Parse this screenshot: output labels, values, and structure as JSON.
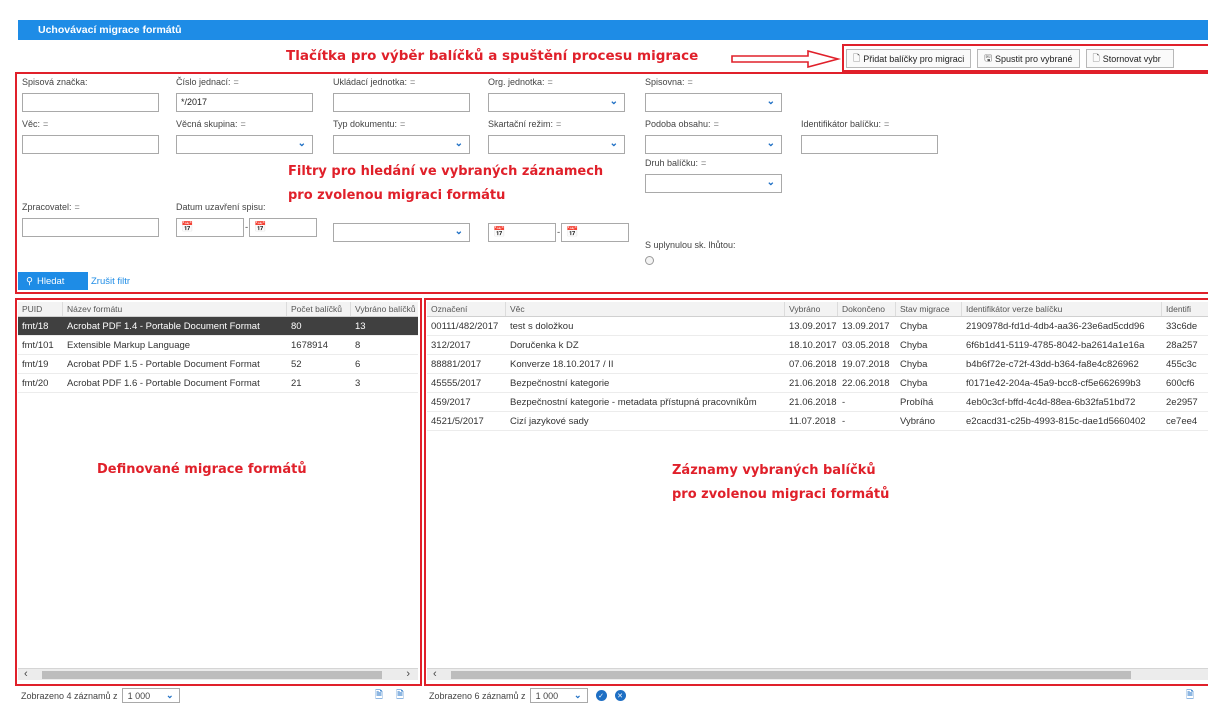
{
  "window": {
    "title": "Uchovávací migrace formátů"
  },
  "annotations": {
    "top": "Tlačítka pro výběr balíčků a spuštění procesu migrace",
    "filters_line1": "Filtry pro hledání ve vybraných záznamech",
    "filters_line2": "pro zvolenou migraci formátu",
    "left_panel": "Definované migrace formátů",
    "right_line1": "Záznamy vybraných balíčků",
    "right_line2": "pro zvolenou migraci formátů"
  },
  "toolbar": {
    "add": "Přidat balíčky pro migraci",
    "run": "Spustit pro vybrané",
    "cancel": "Stornovat vybr"
  },
  "filters": {
    "spisova_znacka": {
      "label": "Spisová značka:",
      "value": ""
    },
    "cislo_jednaci": {
      "label": "Číslo jednací:",
      "eq": "=",
      "value": "*/2017"
    },
    "ukladaci_jednotka": {
      "label": "Ukládací jednotka:",
      "eq": "=",
      "value": ""
    },
    "org_jednotka": {
      "label": "Org. jednotka:",
      "eq": "="
    },
    "spisovna": {
      "label": "Spisovna:",
      "eq": "="
    },
    "vec": {
      "label": "Věc:",
      "eq": "=",
      "value": ""
    },
    "vecna_skupina": {
      "label": "Věcná skupina:",
      "eq": "="
    },
    "typ_dokumentu": {
      "label": "Typ dokumentu:",
      "eq": "="
    },
    "skartacni_rezim": {
      "label": "Skartační režim:",
      "eq": "="
    },
    "podoba_obsahu": {
      "label": "Podoba obsahu:",
      "eq": "="
    },
    "identifikator_balicku": {
      "label": "Identifikátor balíčku:",
      "eq": "=",
      "value": ""
    },
    "druh_balicku": {
      "label": "Druh balíčku:",
      "eq": "="
    },
    "zpracovatel": {
      "label": "Zpracovatel:",
      "eq": "=",
      "value": ""
    },
    "datum_uzavreni": {
      "label": "Datum uzavření spisu:"
    },
    "s_uplynulou": {
      "label": "S uplynulou sk. lhůtou:"
    }
  },
  "buttons": {
    "search": "Hledat",
    "clear": "Zrušit filtr"
  },
  "left_table": {
    "headers": [
      "PUID",
      "Název formátu",
      "Počet balíčků",
      "Vybráno balíčků"
    ],
    "rows": [
      [
        "fmt/18",
        "Acrobat PDF 1.4 - Portable Document Format",
        "80",
        "13"
      ],
      [
        "fmt/101",
        "Extensible Markup Language",
        "1678914",
        "8"
      ],
      [
        "fmt/19",
        "Acrobat PDF 1.5 - Portable Document Format",
        "52",
        "6"
      ],
      [
        "fmt/20",
        "Acrobat PDF 1.6 - Portable Document Format",
        "21",
        "3"
      ]
    ],
    "selected_index": 0
  },
  "right_table": {
    "headers": [
      "Označení",
      "Věc",
      "Vybráno",
      "Dokončeno",
      "Stav migrace",
      "Identifikátor verze balíčku",
      "Identifi"
    ],
    "rows": [
      [
        "00111/482/2017",
        "test s doložkou",
        "13.09.2017",
        "13.09.2017",
        "Chyba",
        "2190978d-fd1d-4db4-aa36-23e6ad5cdd96",
        "33c6de"
      ],
      [
        "312/2017",
        "Doručenka k DZ",
        "18.10.2017",
        "03.05.2018",
        "Chyba",
        "6f6b1d41-5119-4785-8042-ba2614a1e16a",
        "28a257"
      ],
      [
        "88881/2017",
        "Konverze 18.10.2017 / II",
        "07.06.2018",
        "19.07.2018",
        "Chyba",
        "b4b6f72e-c72f-43dd-b364-fa8e4c826962",
        "455c3c"
      ],
      [
        "45555/2017",
        "Bezpečnostní kategorie",
        "21.06.2018",
        "22.06.2018",
        "Chyba",
        "f0171e42-204a-45a9-bcc8-cf5e662699b3",
        "600cf6"
      ],
      [
        "459/2017",
        "Bezpečnostní kategorie - metadata přístupná pracovníkům",
        "21.06.2018",
        "-",
        "Probíhá",
        "4eb0c3cf-bffd-4c4d-88ea-6b32fa51bd72",
        "2e2957"
      ],
      [
        "4521/5/2017",
        "Cizí jazykové sady",
        "11.07.2018",
        "-",
        "Vybráno",
        "e2cacd31-c25b-4993-815c-dae1d5660402",
        "ce7ee4"
      ]
    ]
  },
  "footer": {
    "left_text": "Zobrazeno 4 záznamů z",
    "left_page_size": "1 000",
    "right_text": "Zobrazeno 6 záznamů z",
    "right_page_size": "1 000"
  },
  "icons": {
    "search": "search-icon",
    "calendar": "calendar-icon",
    "chevron": "chevron-down-icon",
    "export": "export-icon",
    "check": "check-circle-icon",
    "close": "close-circle-icon"
  },
  "colors": {
    "accent": "#1e8ce6",
    "annotation": "#e0202a",
    "selected_row": "#404040"
  }
}
